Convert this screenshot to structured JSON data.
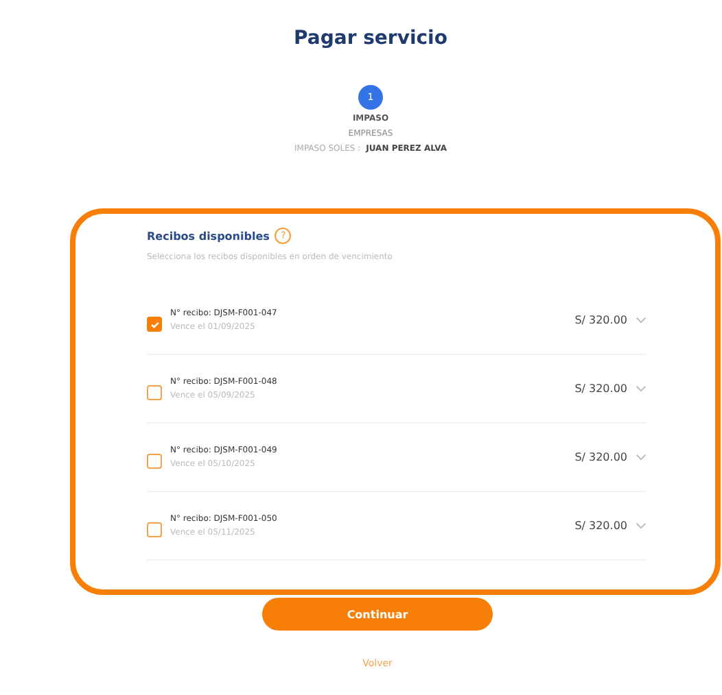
{
  "title": "Pagar servicio",
  "step": {
    "number": "1",
    "label": "IMPASO"
  },
  "company": "EMPRESAS",
  "holder": {
    "label": "IMPASO SOLES :",
    "value": "JUAN PEREZ ALVA"
  },
  "receipts": {
    "title": "Recibos disponibles",
    "hint": "?",
    "subtitle": "Selecciona los recibos disponibles en orden de vencimiento",
    "items": [
      {
        "number": "N° recibo: DJSM-F001-047",
        "due": "Vence el 01/09/2025",
        "amount": "S/ 320.00",
        "checked": true
      },
      {
        "number": "N° recibo: DJSM-F001-048",
        "due": "Vence el 05/09/2025",
        "amount": "S/ 320.00",
        "checked": false
      },
      {
        "number": "N° recibo: DJSM-F001-049",
        "due": "Vence el 05/10/2025",
        "amount": "S/ 320.00",
        "checked": false
      },
      {
        "number": "N° recibo: DJSM-F001-050",
        "due": "Vence el 05/11/2025",
        "amount": "S/ 320.00",
        "checked": false
      }
    ]
  },
  "primary_button": "Continuar",
  "back_link": "Volver"
}
